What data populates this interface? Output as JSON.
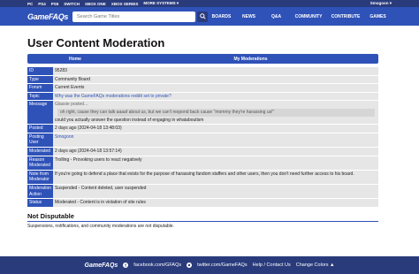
{
  "topbar": {
    "platforms": [
      "PC",
      "PS4",
      "PS5",
      "SWITCH",
      "XBOX ONE",
      "XBOX SERIES",
      "MORE SYSTEMS ▾"
    ],
    "user": "Smogoon ▾"
  },
  "header": {
    "logo": "GameFAQs",
    "search_placeholder": "Search Game Titles",
    "nav": [
      "BOARDS",
      "NEWS",
      "Q&A",
      "COMMUNITY",
      "CONTRIBUTE",
      "GAMES"
    ]
  },
  "page_title": "User Content Moderation",
  "tabs": [
    "Home",
    "My Moderations"
  ],
  "details": {
    "id_label": "ID",
    "id_value": "95283",
    "type_label": "Type",
    "type_value": "Community Board",
    "forum_label": "Forum",
    "forum_value": "Current Events",
    "topic_label": "Topic",
    "topic_value": "Why was the GameFAQs moderations reddit set to private?",
    "message_label": "Message",
    "message_quote_by": "Glassie posted...",
    "message_quote": "oh right, cause they can talk aaaaf about us, but we can't respond back cause \"mommy they're harassing us!\"",
    "message_text": "could you actually answer the question instead of engaging in whataboutism",
    "posted_label": "Posted",
    "posted_value": "2 days ago (2024-04-18 13:48:03)",
    "posting_user_label": "Posting User",
    "posting_user_value": "Smogoon",
    "moderated_label": "Moderated",
    "moderated_value": "2 days ago (2024-04-18 13:57:14)",
    "reason_label": "Reason Moderated",
    "reason_value": "Trolling - Provoking users to react negatively",
    "note_label": "Note from Moderator",
    "note_value": "If you're going to defend a place that exists for the purpose of harassing fandom staffers and other users, then you don't need further access to his board.",
    "action_label": "Moderation Action",
    "action_value": "Suspended - Content deleted, user suspended",
    "status_label": "Status",
    "status_value": "Moderated - Content is in violation of site rules"
  },
  "not_disputable": {
    "title": "Not Disputable",
    "text": "Suspensions, notifications, and community moderations are not disputable."
  },
  "footer": {
    "logo": "GameFAQs",
    "facebook": "facebook.com/GFAQs",
    "twitter": "twitter.com/GameFAQs",
    "help": "Help / Contact Us",
    "colors": "Change Colors ▲"
  },
  "colors": {
    "primary": "#2f52b8",
    "dark": "#2a3b7c",
    "row_bg": "#e6e6e6"
  }
}
